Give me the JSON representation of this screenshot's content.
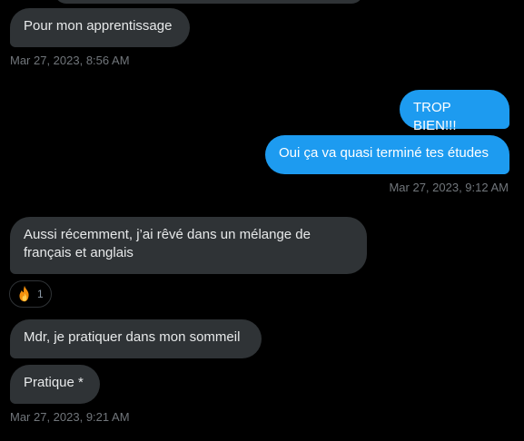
{
  "messages": [
    {
      "text": "Pour mon apprentissage"
    },
    {
      "text": "TROP BIEN!!!"
    },
    {
      "text": "Oui ça va quasi terminé tes études"
    },
    {
      "text": "Aussi récemment, j’ai rêvé dans un mélange de français et anglais"
    },
    {
      "text": "Mdr, je pratiquer dans mon sommeil"
    },
    {
      "text": "Pratique *"
    }
  ],
  "timestamps": [
    "Mar 27, 2023, 8:56 AM",
    "Mar 27, 2023, 9:12 AM",
    "Mar 27, 2023, 9:21 AM"
  ],
  "reaction": {
    "icon": "fire-icon",
    "count": "1"
  },
  "colors": {
    "background": "#000000",
    "incoming_bubble": "#2f3336",
    "outgoing_bubble": "#1d9bf0",
    "timestamp": "#71767b"
  }
}
